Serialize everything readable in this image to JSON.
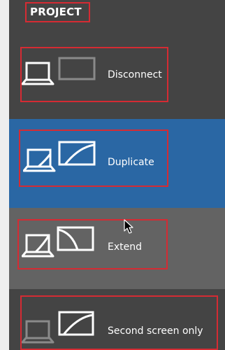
{
  "header": {
    "title": "PROJECT"
  },
  "options": {
    "disconnect": {
      "label": "Disconnect",
      "icon": "disconnect-icon"
    },
    "duplicate": {
      "label": "Duplicate",
      "icon": "duplicate-icon",
      "selected": true
    },
    "extend": {
      "label": "Extend",
      "icon": "extend-icon"
    },
    "second_screen": {
      "label": "Second screen only",
      "icon": "second-screen-only-icon"
    }
  },
  "colors": {
    "panel_bg": "#444444",
    "selected_bg": "#2a67a4",
    "hover_bg": "#636363",
    "highlight_outline": "#d52b33",
    "text": "#ffffff"
  }
}
